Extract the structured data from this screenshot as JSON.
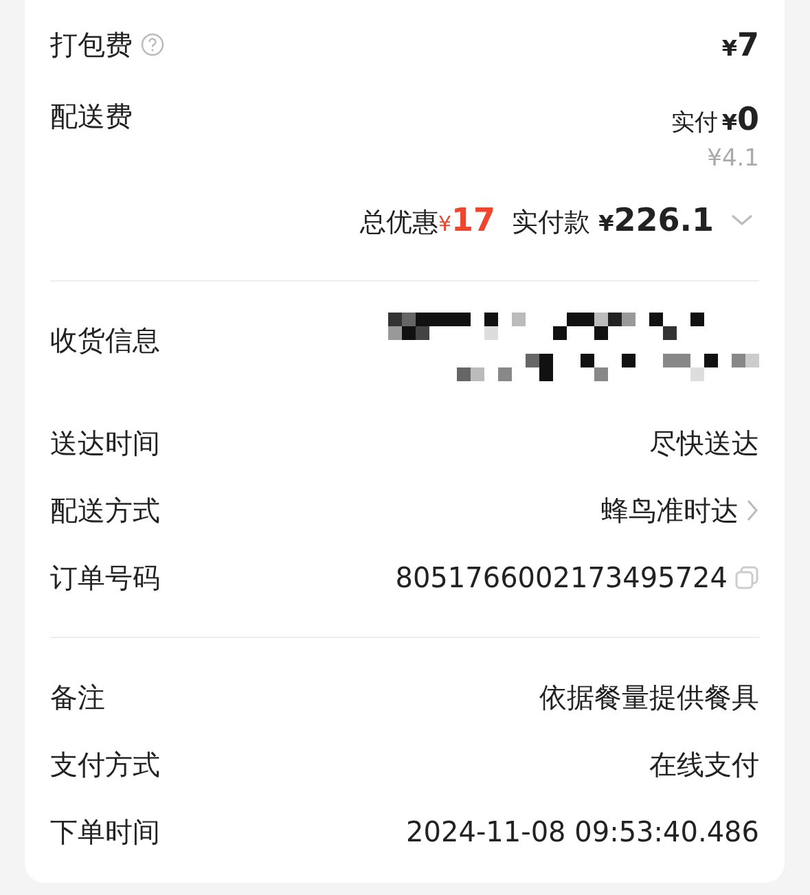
{
  "fees": [
    {
      "kind": "help",
      "label": "打包费",
      "currency": "¥",
      "amount": "7"
    },
    {
      "kind": "discounted",
      "label": "配送费",
      "prefix": "实付",
      "currency": "¥",
      "amount": "0",
      "original": "¥4.1"
    }
  ],
  "summary": {
    "discount_label": "总优惠",
    "discount_currency": "¥",
    "discount": "17",
    "paid_label": "实付款",
    "paid_currency": "¥",
    "paid": "226.1"
  },
  "address": {
    "label": "收货信息"
  },
  "delivery_rows": [
    {
      "kind": "plain",
      "label": "送达时间",
      "value": "尽快送达"
    },
    {
      "kind": "link",
      "label": "配送方式",
      "value": "蜂鸟准时达"
    },
    {
      "kind": "copy",
      "label": "订单号码",
      "value": "8051766002173495724"
    }
  ],
  "order_rows": [
    {
      "kind": "plain",
      "label": "备注",
      "value": "依据餐量提供餐具"
    },
    {
      "kind": "plain",
      "label": "支付方式",
      "value": "在线支付"
    },
    {
      "kind": "plain",
      "label": "下单时间",
      "value": "2024-11-08 09:53:40.486"
    }
  ]
}
